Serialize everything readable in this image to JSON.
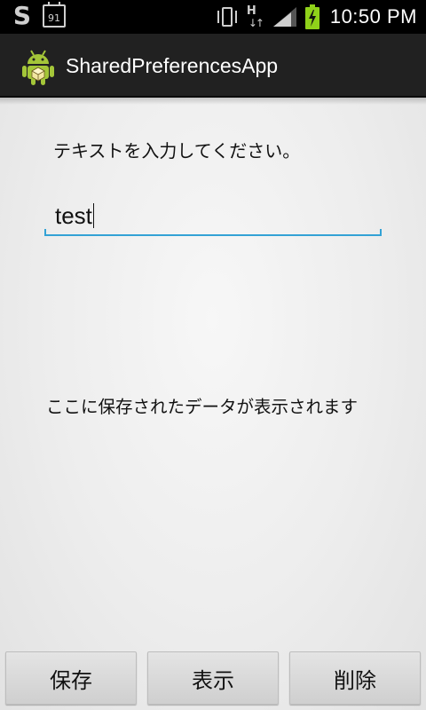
{
  "status_bar": {
    "time": "10:50 PM",
    "calendar_day": "91",
    "network_type": "H",
    "network_arrows": "↓↑",
    "icons": [
      "s-app-icon",
      "calendar-icon",
      "vibrate-icon",
      "network-h-icon",
      "signal-icon",
      "battery-charging-icon"
    ]
  },
  "app": {
    "title": "SharedPreferencesApp",
    "icon": "android-icon"
  },
  "form": {
    "prompt": "テキストを入力してください。",
    "input_value": "test"
  },
  "output": {
    "text": "ここに保存されたデータが表示されます"
  },
  "buttons": {
    "save": "保存",
    "show": "表示",
    "delete": "削除"
  },
  "colors": {
    "accent": "#33a2d5",
    "action_bar": "#212121",
    "status_bar": "#000000",
    "battery": "#8fd11a",
    "android_green": "#a4c639"
  }
}
